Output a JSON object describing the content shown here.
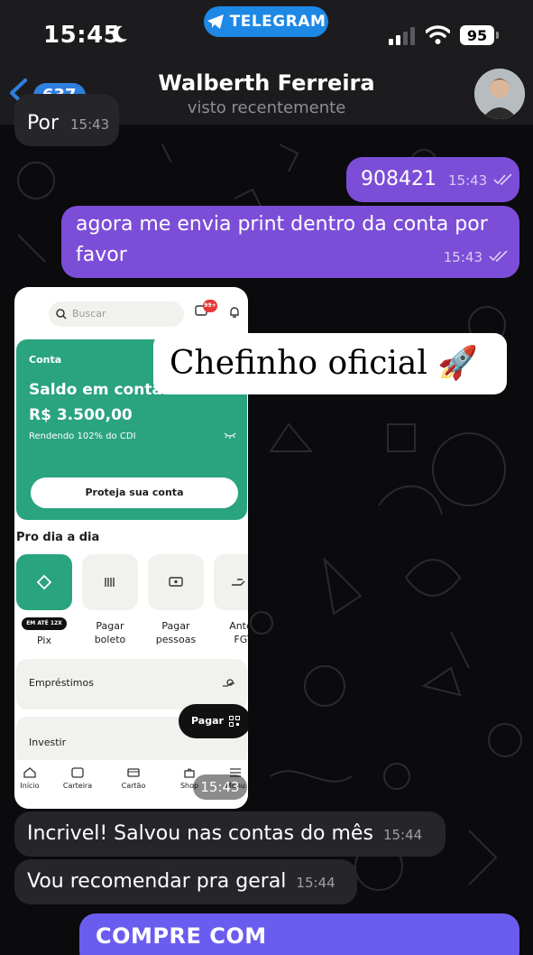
{
  "status_bar": {
    "time": "15:45",
    "pill_label": "TELEGRAM",
    "battery": "95"
  },
  "header": {
    "back_count": "637",
    "name": "Walberth Ferreira",
    "status": "visto recentemente"
  },
  "messages": [
    {
      "dir": "in",
      "text": "Por",
      "time": "15:43"
    },
    {
      "dir": "out",
      "text": "908421",
      "time": "15:43"
    },
    {
      "dir": "out",
      "text": "agora me envia print dentro da conta por favor",
      "time": "15:43"
    },
    {
      "dir": "in",
      "type": "photo",
      "time": "15:43"
    },
    {
      "dir": "in",
      "text": "Incrivel! Salvou nas contas do mês",
      "time": "15:44"
    },
    {
      "dir": "in",
      "text": "Vou recomendar pra geral",
      "time": "15:44"
    }
  ],
  "photo": {
    "search_placeholder": "Buscar",
    "badge": "99+",
    "account_label": "Conta",
    "balance_title": "Saldo em conta",
    "balance_value": "R$ 3.500,00",
    "yield_text": "Rendendo 102% do CDI",
    "protect_button": "Proteja sua conta",
    "section_title": "Pro dia a dia",
    "pix_badge": "EM ATÉ 12X",
    "tiles": [
      {
        "label": "Pix",
        "icon": "pix-icon"
      },
      {
        "label": "Pagar boleto",
        "icon": "barcode-icon"
      },
      {
        "label": "Pagar pessoas",
        "icon": "transfer-icon"
      },
      {
        "label": "Antecipar FGTS",
        "icon": "fgts-icon"
      }
    ],
    "tile_labels_visible": [
      "Pix",
      "Pagar\nboleto",
      "Pagar\npessoas",
      "Antec\nFGT"
    ],
    "row1": "Empréstimos",
    "row2": "Investir",
    "pay_button": "Pagar",
    "nav": [
      "Início",
      "Carteira",
      "Cartão",
      "Shop",
      "Menu"
    ],
    "caption": "Chefinho oficial 🚀"
  },
  "bottom_button": "COMPRE COM",
  "colors": {
    "outgoing_bubble": "#7c4ed7",
    "incoming_bubble": "#26252a",
    "accent_green": "#2aa37f",
    "telegram_blue": "#1e88e5"
  }
}
